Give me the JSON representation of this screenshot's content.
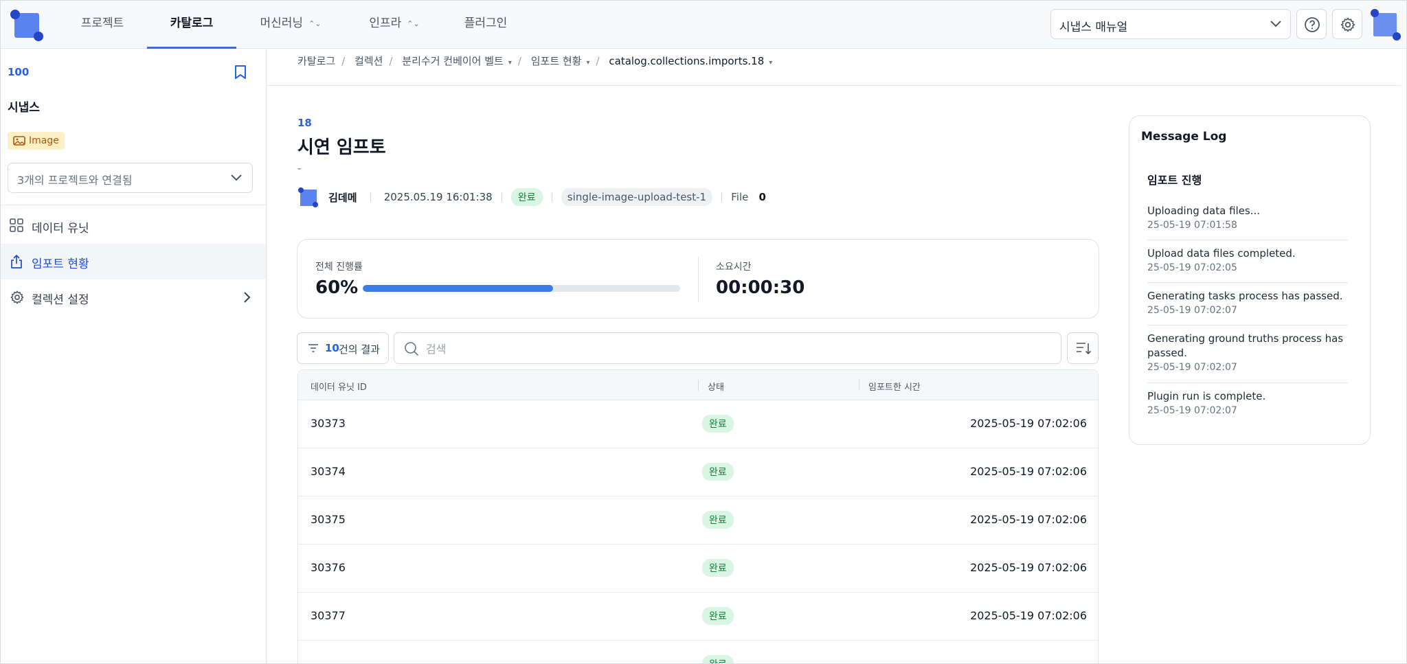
{
  "nav": {
    "items": [
      {
        "label": "프로젝트",
        "active": false,
        "has_dropdown": false
      },
      {
        "label": "카탈로그",
        "active": true,
        "has_dropdown": false
      },
      {
        "label": "머신러닝",
        "active": false,
        "has_dropdown": true
      },
      {
        "label": "인프라",
        "active": false,
        "has_dropdown": true
      },
      {
        "label": "플러그인",
        "active": false,
        "has_dropdown": false
      }
    ],
    "manual_select": "시냅스 매뉴얼"
  },
  "sidebar": {
    "id": "100",
    "title": "시냅스",
    "badge": "Image",
    "project_select": "3개의 프로젝트와 연결됨",
    "items": [
      {
        "label": "데이터 유닛",
        "icon": "grid-icon",
        "active": false
      },
      {
        "label": "임포트 현황",
        "icon": "upload-icon",
        "active": true
      },
      {
        "label": "컬렉션 설정",
        "icon": "gear-icon",
        "active": false
      }
    ]
  },
  "breadcrumb": {
    "items": [
      "카탈로그",
      "컬렉션",
      "분리수거 컨베이어 벨트",
      "임포트 현황",
      "catalog.collections.imports.18"
    ]
  },
  "import": {
    "id": "18",
    "title": "시연 임프토",
    "description": "-",
    "author": "김데메",
    "date": "2025.05.19 16:01:38",
    "status": "완료",
    "chip": "single-image-upload-test-1",
    "file_label": "File",
    "file_count": "0"
  },
  "progress": {
    "label": "전체 진행률",
    "value_text": "60%",
    "value": 0.6,
    "time_label": "소요시간",
    "time_value": "00:00:30"
  },
  "filter": {
    "count": "10",
    "suffix": "건의 결과",
    "search_placeholder": "검색"
  },
  "table": {
    "columns": [
      "데이터 유닛 ID",
      "상태",
      "임포트한 시간"
    ],
    "rows": [
      {
        "id": "30373",
        "status": "완료",
        "time": "2025-05-19 07:02:06"
      },
      {
        "id": "30374",
        "status": "완료",
        "time": "2025-05-19 07:02:06"
      },
      {
        "id": "30375",
        "status": "완료",
        "time": "2025-05-19 07:02:06"
      },
      {
        "id": "30376",
        "status": "완료",
        "time": "2025-05-19 07:02:06"
      },
      {
        "id": "30377",
        "status": "완료",
        "time": "2025-05-19 07:02:06"
      },
      {
        "id": "",
        "status": "완료",
        "time": ""
      }
    ]
  },
  "message_log": {
    "title": "Message Log",
    "subtitle": "임포트 진행",
    "entries": [
      {
        "message": "Uploading data files...",
        "time": "25-05-19 07:01:58"
      },
      {
        "message": "Upload data files completed.",
        "time": "25-05-19 07:02:05"
      },
      {
        "message": "Generating tasks process has passed.",
        "time": "25-05-19 07:02:07"
      },
      {
        "message": "Generating ground truths process has passed.",
        "time": "25-05-19 07:02:07"
      },
      {
        "message": "Plugin run is complete.",
        "time": "25-05-19 07:02:07"
      }
    ]
  },
  "colors": {
    "accent": "#2563eb",
    "progress_fill": "#3b7be4",
    "status_green_bg": "#d9f5e3",
    "status_green_text": "#15803d",
    "badge_yellow_bg": "#fdf0c7"
  }
}
